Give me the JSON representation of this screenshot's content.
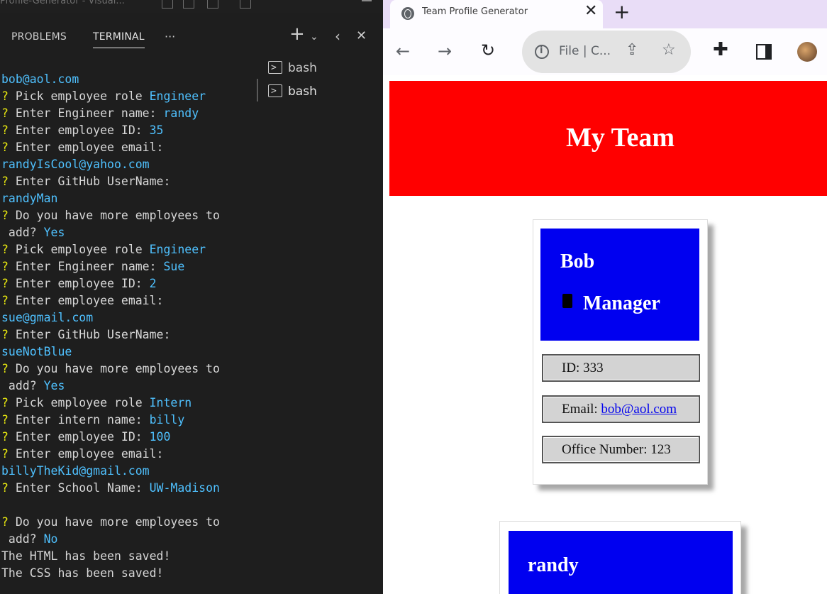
{
  "vscode": {
    "window_title": "Profile-Generator - Visual...",
    "panel_tabs": [
      "PROBLEMS",
      "TERMINAL"
    ],
    "more_label": "···",
    "icons": [
      "plus-icon",
      "chevron-down-icon",
      "chevron-left-icon",
      "close-icon"
    ],
    "shells": [
      "bash",
      "bash"
    ],
    "terminal_lines": [
      {
        "prompt": "",
        "text": "",
        "answer": "bob@aol.com"
      },
      {
        "prompt": "?",
        "text": " Pick employee role ",
        "answer": "Engineer"
      },
      {
        "prompt": "?",
        "text": " Enter Engineer name: ",
        "answer": "randy"
      },
      {
        "prompt": "?",
        "text": " Enter employee ID: ",
        "answer": "35"
      },
      {
        "prompt": "?",
        "text": " Enter employee email:",
        "answer": ""
      },
      {
        "prompt": "",
        "text": "",
        "answer": "randyIsCool@yahoo.com"
      },
      {
        "prompt": "?",
        "text": " Enter GitHub UserName:",
        "answer": ""
      },
      {
        "prompt": "",
        "text": "",
        "answer": "randyMan"
      },
      {
        "prompt": "?",
        "text": " Do you have more employees to",
        "answer": ""
      },
      {
        "prompt": "",
        "text": " add? ",
        "answer": "Yes"
      },
      {
        "prompt": "?",
        "text": " Pick employee role ",
        "answer": "Engineer"
      },
      {
        "prompt": "?",
        "text": " Enter Engineer name: ",
        "answer": "Sue"
      },
      {
        "prompt": "?",
        "text": " Enter employee ID: ",
        "answer": "2"
      },
      {
        "prompt": "?",
        "text": " Enter employee email:",
        "answer": ""
      },
      {
        "prompt": "",
        "text": "",
        "answer": "sue@gmail.com"
      },
      {
        "prompt": "?",
        "text": " Enter GitHub UserName:",
        "answer": ""
      },
      {
        "prompt": "",
        "text": "",
        "answer": "sueNotBlue"
      },
      {
        "prompt": "?",
        "text": " Do you have more employees to",
        "answer": ""
      },
      {
        "prompt": "",
        "text": " add? ",
        "answer": "Yes"
      },
      {
        "prompt": "?",
        "text": " Pick employee role ",
        "answer": "Intern"
      },
      {
        "prompt": "?",
        "text": " Enter intern name: ",
        "answer": "billy"
      },
      {
        "prompt": "?",
        "text": " Enter employee ID: ",
        "answer": "100"
      },
      {
        "prompt": "?",
        "text": " Enter employee email:",
        "answer": ""
      },
      {
        "prompt": "",
        "text": "",
        "answer": "billyTheKid@gmail.com"
      },
      {
        "prompt": "?",
        "text": " Enter School Name: ",
        "answer": "UW-Madison"
      },
      {
        "prompt": "",
        "text": "",
        "answer": ""
      },
      {
        "prompt": "?",
        "text": " Do you have more employees to",
        "answer": ""
      },
      {
        "prompt": "",
        "text": " add? ",
        "answer": "No"
      },
      {
        "prompt": "",
        "text": "The HTML has been saved!",
        "answer": ""
      },
      {
        "prompt": "",
        "text": "The CSS has been saved!",
        "answer": ""
      }
    ]
  },
  "browser": {
    "tab_title": "Team Profile Generator",
    "new_tab_label": "+",
    "close_label": "✕",
    "omnibox_text": "File | C...",
    "nav_icons": [
      "back-icon",
      "forward-icon",
      "reload-icon",
      "share-icon",
      "star-icon",
      "extensions-icon",
      "sidepanel-icon",
      "profile-avatar"
    ]
  },
  "page": {
    "header_title": "My Team",
    "cards": [
      {
        "name": "Bob",
        "role": "Manager",
        "id_label": "ID: 333",
        "email_prefix": "Email: ",
        "email": "bob@aol.com",
        "office_label": "Office Number: 123"
      },
      {
        "name": "randy"
      }
    ]
  },
  "colors": {
    "header_bg": "#ff0000",
    "card_head_bg": "#0000f0",
    "info_bg": "#d3d3d3",
    "terminal_answer": "#4fc1ff",
    "terminal_prompt": "#e5e510"
  }
}
